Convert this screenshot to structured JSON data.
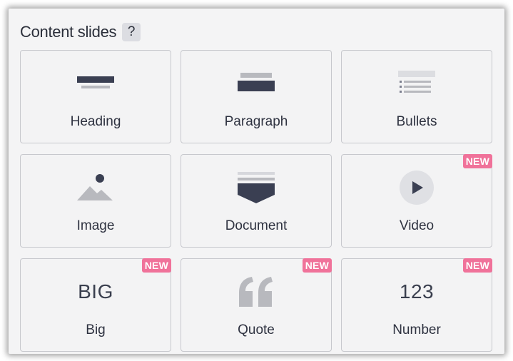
{
  "panel": {
    "title": "Content slides",
    "help": "?"
  },
  "badge_text": "NEW",
  "colors": {
    "badge": "#f0729a",
    "icon_dark": "#3a3f52",
    "icon_light": "#b8b9be"
  },
  "tiles": [
    {
      "label": "Heading",
      "icon": "heading-icon",
      "new": false
    },
    {
      "label": "Paragraph",
      "icon": "paragraph-icon",
      "new": false
    },
    {
      "label": "Bullets",
      "icon": "bullets-icon",
      "new": false
    },
    {
      "label": "Image",
      "icon": "image-icon",
      "new": false
    },
    {
      "label": "Document",
      "icon": "document-icon",
      "new": false
    },
    {
      "label": "Video",
      "icon": "video-icon",
      "new": true
    },
    {
      "label": "Big",
      "icon": "big-icon",
      "icon_text": "BIG",
      "new": true
    },
    {
      "label": "Quote",
      "icon": "quote-icon",
      "new": true
    },
    {
      "label": "Number",
      "icon": "number-icon",
      "icon_text": "123",
      "new": true
    }
  ]
}
